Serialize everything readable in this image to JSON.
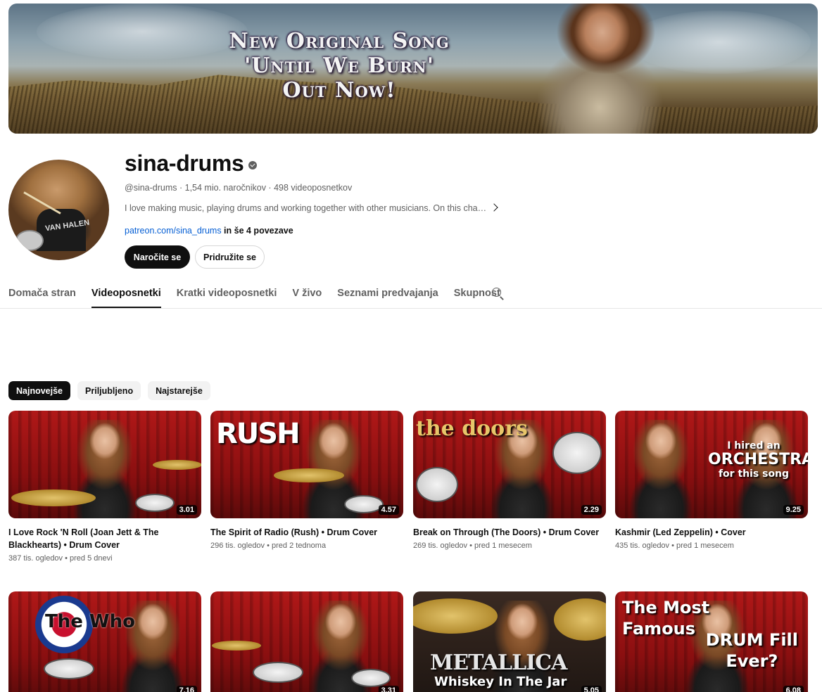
{
  "banner": {
    "line1": "New Original Song",
    "line2": "'Until We Burn'",
    "line3": "Out Now!"
  },
  "channel": {
    "name": "sina-drums",
    "meta": "@sina-drums · 1,54 mio. naročnikov · 498 videoposnetkov",
    "description": "I love making music, playing drums and working together with other musicians. On this channel...",
    "link_text": "patreon.com/sina_drums",
    "link_suffix": " in še 4 povezave",
    "subscribe_label": "Naročite se",
    "join_label": "Pridružite se",
    "avatar_shirt_text": "VAN HALEN"
  },
  "tabs": [
    {
      "label": "Domača stran"
    },
    {
      "label": "Videoposnetki"
    },
    {
      "label": "Kratki videoposnetki"
    },
    {
      "label": "V živo"
    },
    {
      "label": "Seznami predvajanja"
    },
    {
      "label": "Skupnost"
    }
  ],
  "active_tab": "Videoposnetki",
  "chips": [
    {
      "label": "Najnovejše"
    },
    {
      "label": "Priljubljeno"
    },
    {
      "label": "Najstarejše"
    }
  ],
  "videos": [
    {
      "title": "I Love Rock 'N Roll (Joan Jett & The Blackhearts) • Drum Cover",
      "meta": "387 tis. ogledov • pred 5 dnevi",
      "duration": "3.01"
    },
    {
      "title": "The Spirit of Radio (Rush) • Drum Cover",
      "meta": "296 tis. ogledov • pred 2 tednoma",
      "duration": "4.57",
      "overlay": "RUSH"
    },
    {
      "title": "Break on Through (The Doors) • Drum Cover",
      "meta": "269 tis. ogledov • pred 1 mesecem",
      "duration": "2.29",
      "overlay": "the doors"
    },
    {
      "title": "Kashmir (Led Zeppelin) • Cover",
      "meta": "435 tis. ogledov • pred 1 mesecem",
      "duration": "9.25",
      "overlay_1": "I hired an",
      "overlay_2": "ORCHESTRA",
      "overlay_3": "for this song"
    },
    {
      "title": "",
      "meta": "",
      "duration": "7.16",
      "overlay": "The Who"
    },
    {
      "title": "",
      "meta": "",
      "duration": "3.31"
    },
    {
      "title": "",
      "meta": "",
      "duration": "5.05",
      "overlay_1": "METALLICA",
      "overlay_2": "Whiskey In The Jar"
    },
    {
      "title": "",
      "meta": "",
      "duration": "6.08",
      "overlay_1": "The Most",
      "overlay_2": "Famous",
      "overlay_3": "DRUM Fill",
      "overlay_4": "Ever?"
    }
  ],
  "colors": {
    "subscribe_bg": "#0f0f0f",
    "link": "#065fd4",
    "secondary_text": "#606060"
  }
}
